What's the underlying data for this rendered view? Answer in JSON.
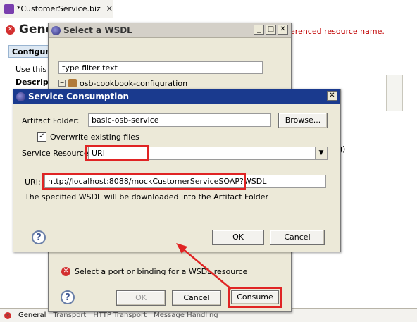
{
  "editor": {
    "tab_title": "*CustomerService.biz",
    "title": "Gene",
    "error_text": "erenced resource name.",
    "tab_config": "Configur",
    "use_text": "Use this p",
    "descr_text": "Descript",
    "right_text": "ng)",
    "bottom_tabs": [
      "General",
      "Transport",
      "HTTP Transport",
      "Message Handling"
    ]
  },
  "wsdl_dialog": {
    "title": "Select a WSDL",
    "filter_placeholder": "type filter text",
    "tree_item": "osb-cookbook-configuration",
    "error_message": "Select a port or binding for a WSDL resource",
    "buttons": {
      "ok": "OK",
      "cancel": "Cancel",
      "consume": "Consume"
    }
  },
  "service_dialog": {
    "title": "Service Consumption",
    "artifact_label": "Artifact Folder:",
    "artifact_value": "basic-osb-service",
    "browse": "Browse...",
    "overwrite_label": "Overwrite existing files",
    "overwrite_checked": true,
    "resource_label": "Service Resource:",
    "resource_value": "URI",
    "uri_label": "URI:",
    "uri_value": "http://localhost:8088/mockCustomerServiceSOAP?WSDL",
    "info_text": "The specified WSDL will be downloaded into the Artifact Folder",
    "buttons": {
      "ok": "OK",
      "cancel": "Cancel"
    }
  },
  "colors": {
    "highlight": "#e02424",
    "active_title": "#1a3a8e",
    "dialog_bg": "#ece9d8"
  }
}
